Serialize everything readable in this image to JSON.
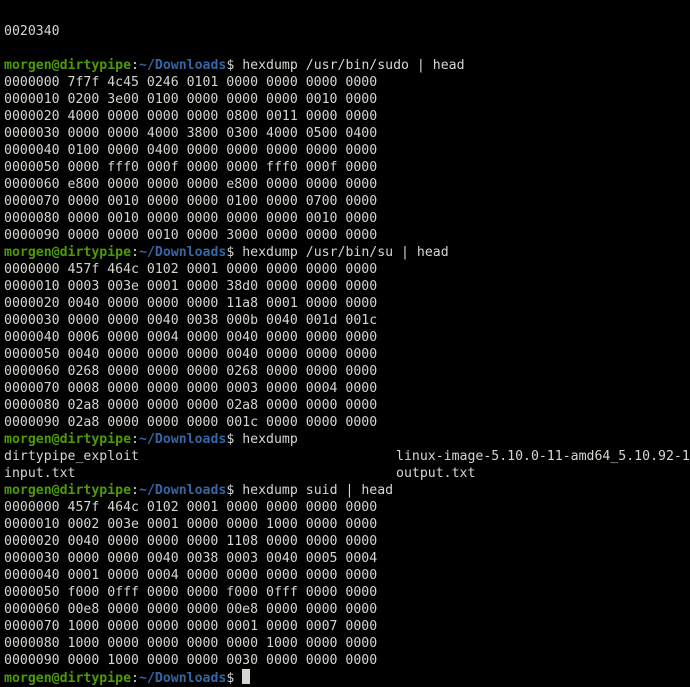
{
  "partial_top_line": "0020340",
  "prompt": {
    "user_host": "morgen@dirtypipe",
    "colon": ":",
    "path": "~/Downloads",
    "dollar": "$ "
  },
  "blocks": [
    {
      "command": "hexdump /usr/bin/sudo | head",
      "output": [
        "0000000 7f7f 4c45 0246 0101 0000 0000 0000 0000",
        "0000010 0200 3e00 0100 0000 0000 0000 0010 0000",
        "0000020 4000 0000 0000 0000 0800 0011 0000 0000",
        "0000030 0000 0000 4000 3800 0300 4000 0500 0400",
        "0000040 0100 0000 0400 0000 0000 0000 0000 0000",
        "0000050 0000 fff0 000f 0000 0000 fff0 000f 0000",
        "0000060 e800 0000 0000 0000 e800 0000 0000 0000",
        "0000070 0000 0010 0000 0000 0100 0000 0700 0000",
        "0000080 0000 0010 0000 0000 0000 0000 0010 0000",
        "0000090 0000 0000 0010 0000 3000 0000 0000 0000"
      ]
    },
    {
      "command": "hexdump /usr/bin/su | head",
      "output": [
        "0000000 457f 464c 0102 0001 0000 0000 0000 0000",
        "0000010 0003 003e 0001 0000 38d0 0000 0000 0000",
        "0000020 0040 0000 0000 0000 11a8 0001 0000 0000",
        "0000030 0000 0000 0040 0038 000b 0040 001d 001c",
        "0000040 0006 0000 0004 0000 0040 0000 0000 0000",
        "0000050 0040 0000 0000 0000 0040 0000 0000 0000",
        "0000060 0268 0000 0000 0000 0268 0000 0000 0000",
        "0000070 0008 0000 0000 0000 0003 0000 0004 0000",
        "0000080 02a8 0000 0000 0000 02a8 0000 0000 0000",
        "0000090 02a8 0000 0000 0000 001c 0000 0000 0000"
      ]
    },
    {
      "command": "hexdump",
      "listing": [
        {
          "left": "dirtypipe_exploit",
          "right": "linux-image-5.10.0-11-amd64_5.10.92-1"
        },
        {
          "left": "input.txt",
          "right": "output.txt"
        }
      ]
    },
    {
      "command": "hexdump suid | head",
      "output": [
        "0000000 457f 464c 0102 0001 0000 0000 0000 0000",
        "0000010 0002 003e 0001 0000 0000 1000 0000 0000",
        "0000020 0040 0000 0000 0000 1108 0000 0000 0000",
        "0000030 0000 0000 0040 0038 0003 0040 0005 0004",
        "0000040 0001 0000 0004 0000 0000 0000 0000 0000",
        "0000050 f000 0fff 0000 0000 f000 0fff 0000 0000",
        "0000060 00e8 0000 0000 0000 00e8 0000 0000 0000",
        "0000070 1000 0000 0000 0000 0001 0000 0007 0000",
        "0000080 1000 0000 0000 0000 0000 1000 0000 0000",
        "0000090 0000 1000 0000 0000 0030 0000 0000 0000"
      ]
    }
  ],
  "final_prompt_command": "",
  "colors": {
    "background": "#000000",
    "foreground": "#d3d7cf",
    "user_host": "#4e9a06",
    "path": "#3465a4"
  }
}
